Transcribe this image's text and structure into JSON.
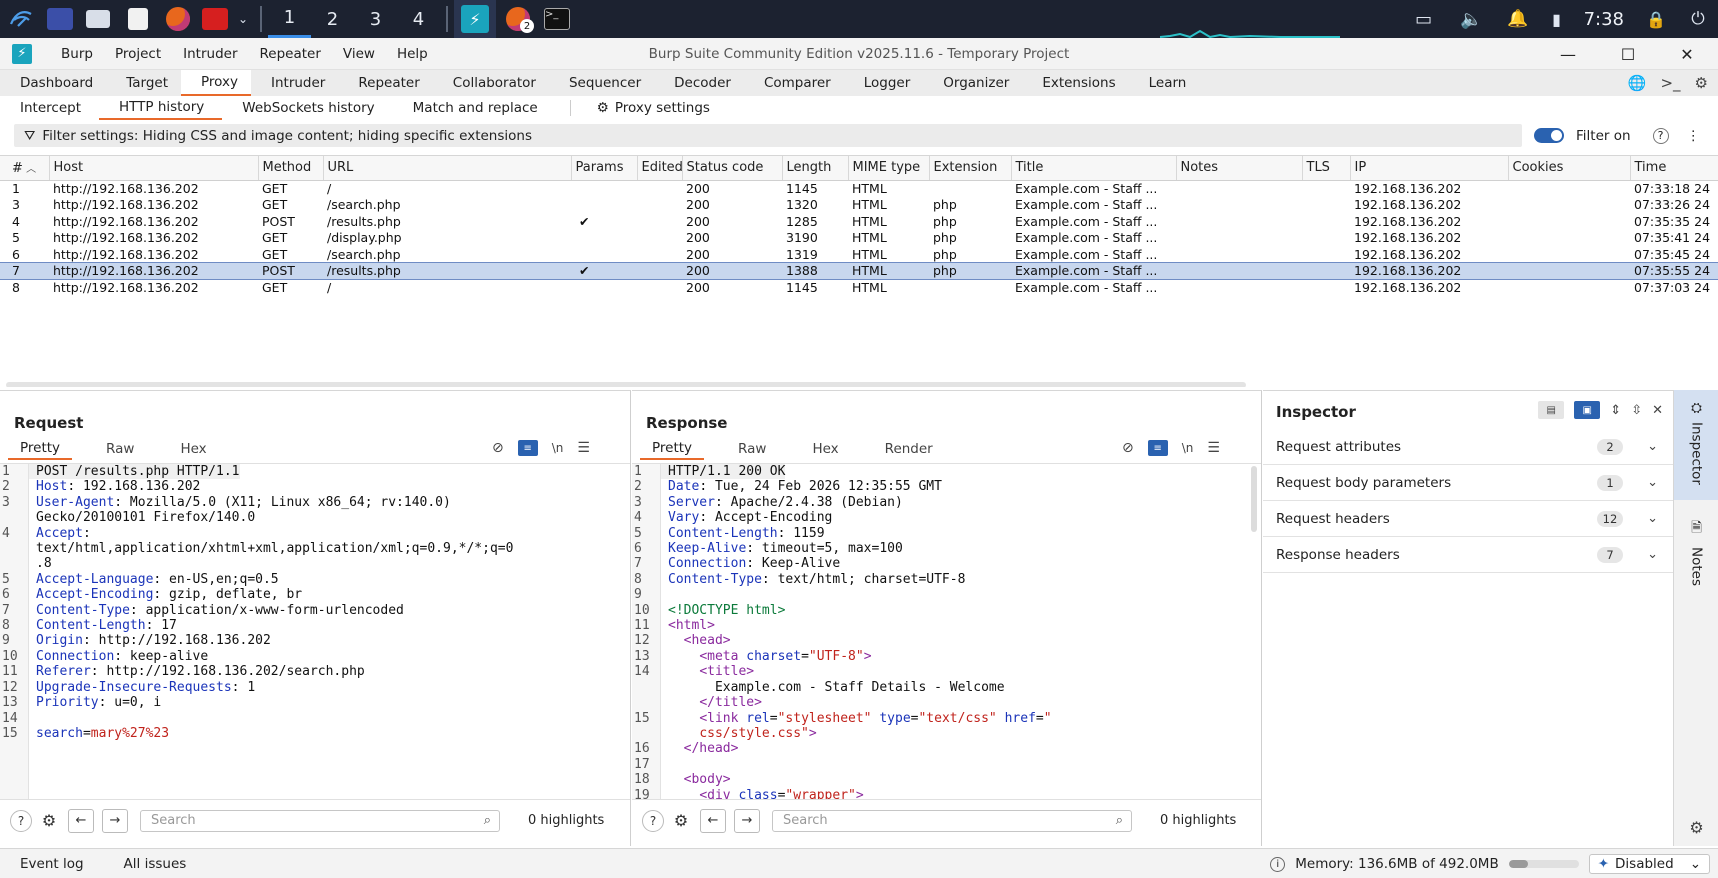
{
  "taskbar": {
    "workspaces": [
      "1",
      "2",
      "3",
      "4"
    ],
    "active_workspace": "1",
    "clock": "7:38",
    "firefox_badge": "2"
  },
  "window": {
    "title": "Burp Suite Community Edition v2025.11.6 - Temporary Project",
    "menu": [
      "Burp",
      "Project",
      "Intruder",
      "Repeater",
      "View",
      "Help"
    ]
  },
  "main_tabs": [
    "Dashboard",
    "Target",
    "Proxy",
    "Intruder",
    "Repeater",
    "Collaborator",
    "Sequencer",
    "Decoder",
    "Comparer",
    "Logger",
    "Organizer",
    "Extensions",
    "Learn"
  ],
  "active_main_tab": "Proxy",
  "sub_tabs": [
    "Intercept",
    "HTTP history",
    "WebSockets history",
    "Match and replace"
  ],
  "active_sub_tab": "HTTP history",
  "proxy_settings_label": "Proxy settings",
  "filter": {
    "text": "Filter settings: Hiding CSS and image content; hiding specific extensions",
    "filter_on_label": "Filter on"
  },
  "history": {
    "columns": [
      "#",
      "Host",
      "Method",
      "URL",
      "Params",
      "Edited",
      "Status code",
      "Length",
      "MIME type",
      "Extension",
      "Title",
      "Notes",
      "TLS",
      "IP",
      "Cookies",
      "Time"
    ],
    "rows": [
      {
        "n": "1",
        "host": "http://192.168.136.202",
        "method": "GET",
        "url": "/",
        "params": "",
        "edited": "",
        "status": "200",
        "length": "1145",
        "mime": "HTML",
        "ext": "",
        "title": "Example.com - Staff ...",
        "notes": "",
        "tls": "",
        "ip": "192.168.136.202",
        "cookies": "",
        "time": "07:33:18 24"
      },
      {
        "n": "3",
        "host": "http://192.168.136.202",
        "method": "GET",
        "url": "/search.php",
        "params": "",
        "edited": "",
        "status": "200",
        "length": "1320",
        "mime": "HTML",
        "ext": "php",
        "title": "Example.com - Staff ...",
        "notes": "",
        "tls": "",
        "ip": "192.168.136.202",
        "cookies": "",
        "time": "07:33:26 24"
      },
      {
        "n": "4",
        "host": "http://192.168.136.202",
        "method": "POST",
        "url": "/results.php",
        "params": "✔",
        "edited": "",
        "status": "200",
        "length": "1285",
        "mime": "HTML",
        "ext": "php",
        "title": "Example.com - Staff ...",
        "notes": "",
        "tls": "",
        "ip": "192.168.136.202",
        "cookies": "",
        "time": "07:35:35 24"
      },
      {
        "n": "5",
        "host": "http://192.168.136.202",
        "method": "GET",
        "url": "/display.php",
        "params": "",
        "edited": "",
        "status": "200",
        "length": "3190",
        "mime": "HTML",
        "ext": "php",
        "title": "Example.com - Staff ...",
        "notes": "",
        "tls": "",
        "ip": "192.168.136.202",
        "cookies": "",
        "time": "07:35:41 24"
      },
      {
        "n": "6",
        "host": "http://192.168.136.202",
        "method": "GET",
        "url": "/search.php",
        "params": "",
        "edited": "",
        "status": "200",
        "length": "1319",
        "mime": "HTML",
        "ext": "php",
        "title": "Example.com - Staff ...",
        "notes": "",
        "tls": "",
        "ip": "192.168.136.202",
        "cookies": "",
        "time": "07:35:45 24"
      },
      {
        "n": "7",
        "host": "http://192.168.136.202",
        "method": "POST",
        "url": "/results.php",
        "params": "✔",
        "edited": "",
        "status": "200",
        "length": "1388",
        "mime": "HTML",
        "ext": "php",
        "title": "Example.com - Staff ...",
        "notes": "",
        "tls": "",
        "ip": "192.168.136.202",
        "cookies": "",
        "time": "07:35:55 24",
        "selected": true
      },
      {
        "n": "8",
        "host": "http://192.168.136.202",
        "method": "GET",
        "url": "/",
        "params": "",
        "edited": "",
        "status": "200",
        "length": "1145",
        "mime": "HTML",
        "ext": "",
        "title": "Example.com - Staff ...",
        "notes": "",
        "tls": "",
        "ip": "192.168.136.202",
        "cookies": "",
        "time": "07:37:03 24"
      }
    ]
  },
  "request": {
    "title": "Request",
    "tabs": [
      "Pretty",
      "Raw",
      "Hex"
    ],
    "active_tab": "Pretty",
    "lines": [
      {
        "n": "1",
        "type": "plain",
        "text": "POST /results.php HTTP/1.1"
      },
      {
        "n": "2",
        "type": "header",
        "key": "Host",
        "value": " 192.168.136.202"
      },
      {
        "n": "3",
        "type": "header",
        "key": "User-Agent",
        "value": " Mozilla/5.0 (X11; Linux x86_64; rv:140.0)"
      },
      {
        "n": "",
        "type": "plain",
        "text": "Gecko/20100101 Firefox/140.0"
      },
      {
        "n": "4",
        "type": "header",
        "key": "Accept",
        "value": ""
      },
      {
        "n": "",
        "type": "plain",
        "text": "text/html,application/xhtml+xml,application/xml;q=0.9,*/*;q=0"
      },
      {
        "n": "",
        "type": "plain",
        "text": ".8"
      },
      {
        "n": "5",
        "type": "header",
        "key": "Accept-Language",
        "value": " en-US,en;q=0.5"
      },
      {
        "n": "6",
        "type": "header",
        "key": "Accept-Encoding",
        "value": " gzip, deflate, br"
      },
      {
        "n": "7",
        "type": "header",
        "key": "Content-Type",
        "value": " application/x-www-form-urlencoded"
      },
      {
        "n": "8",
        "type": "header",
        "key": "Content-Length",
        "value": " 17"
      },
      {
        "n": "9",
        "type": "header",
        "key": "Origin",
        "value": " http://192.168.136.202"
      },
      {
        "n": "10",
        "type": "header",
        "key": "Connection",
        "value": " keep-alive"
      },
      {
        "n": "11",
        "type": "header",
        "key": "Referer",
        "value": " http://192.168.136.202/search.php"
      },
      {
        "n": "12",
        "type": "header",
        "key": "Upgrade-Insecure-Requests",
        "value": " 1"
      },
      {
        "n": "13",
        "type": "header",
        "key": "Priority",
        "value": " u=0, i"
      },
      {
        "n": "14",
        "type": "plain",
        "text": ""
      },
      {
        "n": "15",
        "type": "param",
        "key": "search",
        "value": "mary%27%23"
      }
    ],
    "search_placeholder": "Search",
    "highlights": "0 highlights"
  },
  "response": {
    "title": "Response",
    "tabs": [
      "Pretty",
      "Raw",
      "Hex",
      "Render"
    ],
    "active_tab": "Pretty",
    "lines": [
      {
        "n": "1",
        "html": "HTTP/1.1 200 OK"
      },
      {
        "n": "2",
        "html": "<span class='hk'>Date</span>: Tue, 24 Feb 2026 12:35:55 GMT"
      },
      {
        "n": "3",
        "html": "<span class='hk'>Server</span>: Apache/2.4.38 (Debian)"
      },
      {
        "n": "4",
        "html": "<span class='hk'>Vary</span>: Accept-Encoding"
      },
      {
        "n": "5",
        "html": "<span class='hk'>Content-Length</span>: 1159"
      },
      {
        "n": "6",
        "html": "<span class='hk'>Keep-Alive</span>: timeout=5, max=100"
      },
      {
        "n": "7",
        "html": "<span class='hk'>Connection</span>: Keep-Alive"
      },
      {
        "n": "8",
        "html": "<span class='hk'>Content-Type</span>: text/html; charset=UTF-8"
      },
      {
        "n": "9",
        "html": ""
      },
      {
        "n": "10",
        "html": "<span class='dt'>&lt;!DOCTYPE html&gt;</span>"
      },
      {
        "n": "11",
        "html": "<span class='tg'>&lt;html&gt;</span>"
      },
      {
        "n": "12",
        "html": "  <span class='tg'>&lt;head&gt;</span>"
      },
      {
        "n": "13",
        "html": "    <span class='tg'>&lt;meta</span> <span class='at'>charset</span>=<span class='av'>\"UTF-8\"</span><span class='tg'>&gt;</span>"
      },
      {
        "n": "14",
        "html": "    <span class='tg'>&lt;title&gt;</span>"
      },
      {
        "n": "",
        "html": "      Example.com - Staff Details - Welcome"
      },
      {
        "n": "",
        "html": "    <span class='tg'>&lt;/title&gt;</span>"
      },
      {
        "n": "15",
        "html": "    <span class='tg'>&lt;link</span> <span class='at'>rel</span>=<span class='av'>\"stylesheet\"</span> <span class='at'>type</span>=<span class='av'>\"text/css\"</span> <span class='at'>href</span>=<span class='av'>\"</span>"
      },
      {
        "n": "",
        "html": "    <span class='av'>css/style.css\"</span><span class='tg'>&gt;</span>"
      },
      {
        "n": "16",
        "html": "  <span class='tg'>&lt;/head&gt;</span>"
      },
      {
        "n": "17",
        "html": ""
      },
      {
        "n": "18",
        "html": "  <span class='tg'>&lt;body&gt;</span>"
      },
      {
        "n": "19",
        "html": "    <span class='tg'>&lt;div</span> <span class='at'>class</span>=<span class='av'>\"wrapper\"</span><span class='tg'>&gt;</span>"
      }
    ],
    "search_placeholder": "Search",
    "highlights": "0 highlights"
  },
  "inspector": {
    "title": "Inspector",
    "sections": [
      {
        "label": "Request attributes",
        "count": "2"
      },
      {
        "label": "Request body parameters",
        "count": "1"
      },
      {
        "label": "Request headers",
        "count": "12"
      },
      {
        "label": "Response headers",
        "count": "7"
      }
    ]
  },
  "side_rail": {
    "inspector_label": "Inspector",
    "notes_label": "Notes"
  },
  "statusbar": {
    "event_log": "Event log",
    "all_issues": "All issues",
    "memory": "Memory: 136.6MB of 492.0MB",
    "memory_fraction": 0.28,
    "disabled": "Disabled"
  },
  "colors": {
    "accent_orange": "#e8692a",
    "selection_blue": "#c8d7ee",
    "toggle_blue": "#2a62b0"
  }
}
